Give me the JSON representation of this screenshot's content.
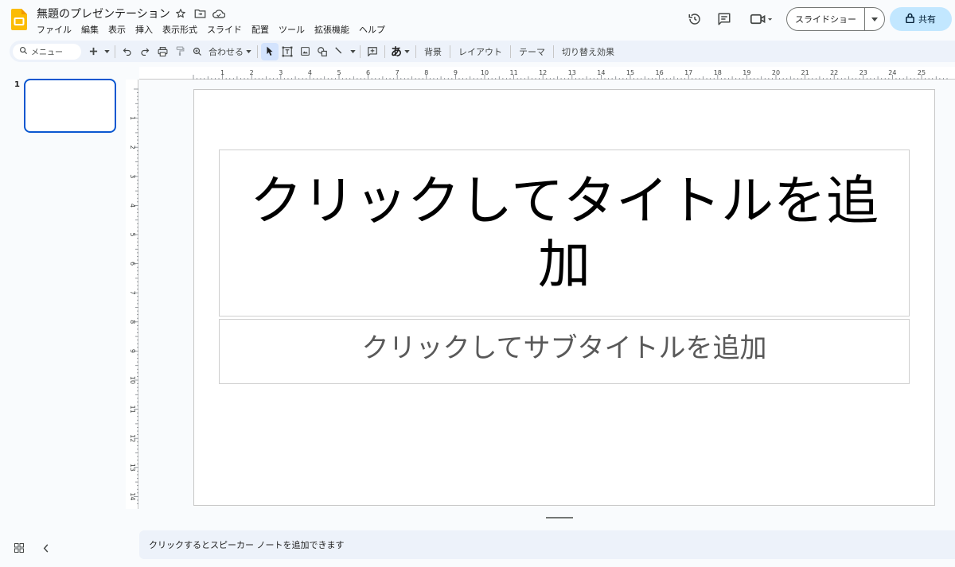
{
  "app": {
    "title": "無題のプレゼンテーション",
    "menu": [
      "ファイル",
      "編集",
      "表示",
      "挿入",
      "表示形式",
      "スライド",
      "配置",
      "ツール",
      "拡張機能",
      "ヘルプ"
    ],
    "slideshow_label": "スライドショー",
    "share_label": "共有",
    "brand_color": "#fbbc04",
    "accent_color": "#0b57d0"
  },
  "toolbar": {
    "search_label": "メニュー",
    "zoom_label": "合わせる",
    "background_label": "背景",
    "layout_label": "レイアウト",
    "theme_label": "テーマ",
    "transition_label": "切り替え効果",
    "text_tool_label": "あ"
  },
  "ruler": {
    "horizontal": [
      "1",
      "2",
      "3",
      "4",
      "5",
      "6",
      "7",
      "8",
      "9",
      "10",
      "11",
      "12",
      "13",
      "14",
      "15",
      "16",
      "17",
      "18",
      "19",
      "20",
      "21",
      "22",
      "23",
      "24",
      "25"
    ],
    "vertical": [
      "1",
      "2",
      "3",
      "4",
      "5",
      "6",
      "7",
      "8",
      "9",
      "10",
      "11",
      "12",
      "13",
      "14"
    ]
  },
  "filmstrip": {
    "slides": [
      {
        "number": "1"
      }
    ]
  },
  "slide": {
    "title_placeholder": "クリックしてタイトルを追加",
    "subtitle_placeholder": "クリックしてサブタイトルを追加"
  },
  "notes": {
    "placeholder": "クリックするとスピーカー ノートを追加できます"
  },
  "icons": [
    "slides-logo-icon",
    "star-icon",
    "folder-move-icon",
    "cloud-saved-icon",
    "history-icon",
    "comment-icon",
    "meet-icon",
    "lock-icon",
    "search-icon",
    "undo-icon",
    "redo-icon",
    "print-icon",
    "paint-format-icon",
    "zoom-icon",
    "select-icon",
    "textbox-icon",
    "image-icon",
    "shape-icon",
    "line-icon",
    "comment-add-icon",
    "grid-view-icon",
    "chevron-left-icon"
  ]
}
